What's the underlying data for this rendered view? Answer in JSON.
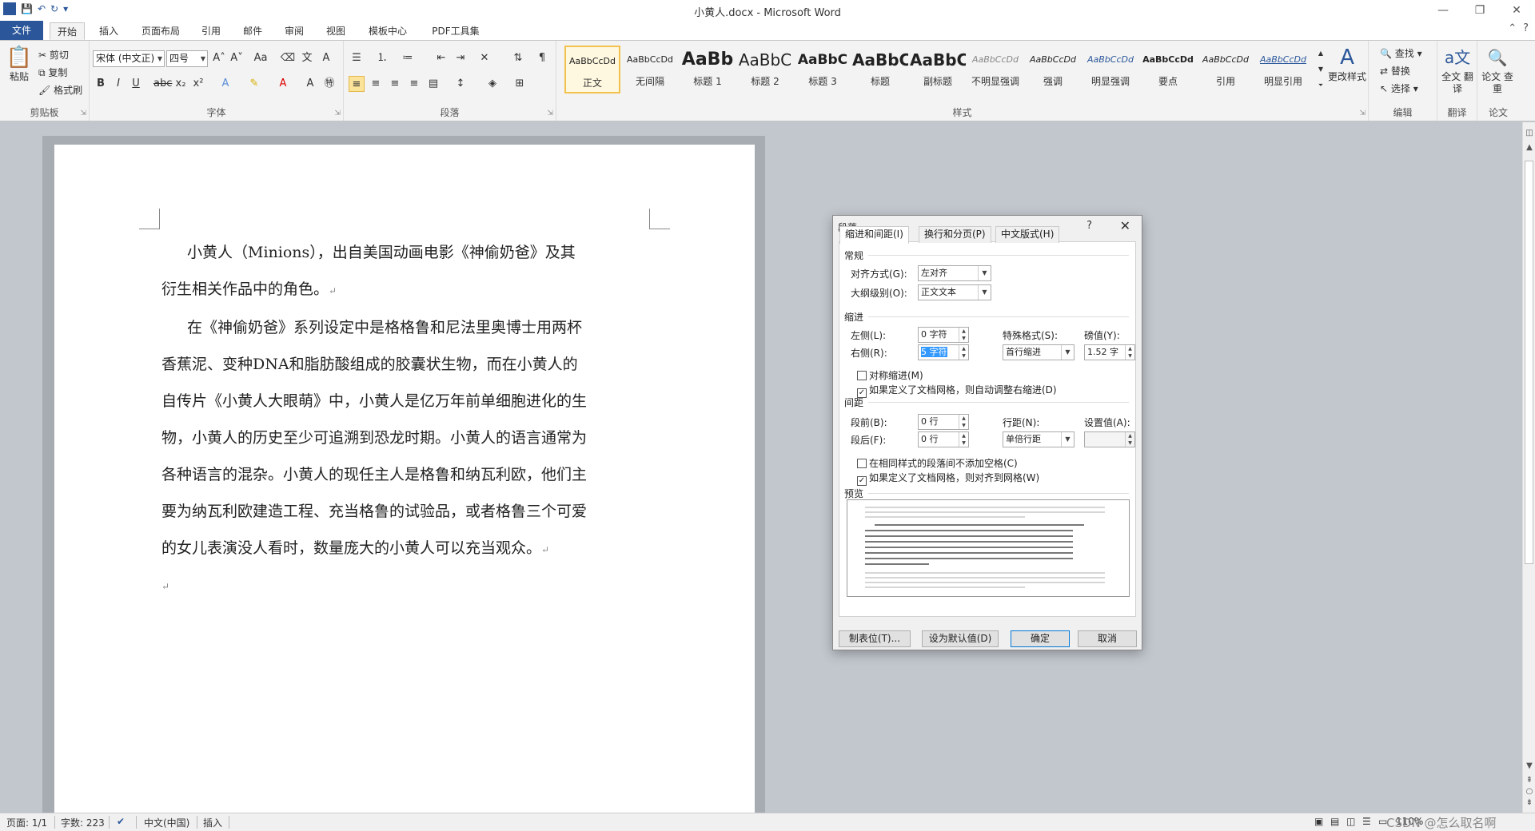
{
  "window": {
    "title": "小黄人.docx - Microsoft Word",
    "logo": "W"
  },
  "tabs": [
    "文件",
    "开始",
    "插入",
    "页面布局",
    "引用",
    "邮件",
    "审阅",
    "视图",
    "模板中心",
    "PDF工具集"
  ],
  "ribbon": {
    "clipboard": {
      "label": "剪贴板",
      "paste": "粘贴",
      "cut": "剪切",
      "copy": "复制",
      "format_painter": "格式刷"
    },
    "font": {
      "label": "字体",
      "font_name": "宋体 (中文正)",
      "font_size": "四号"
    },
    "paragraph": {
      "label": "段落"
    },
    "styles": {
      "label": "样式",
      "items": [
        {
          "preview": "AaBbCcDd",
          "name": "正文"
        },
        {
          "preview": "AaBbCcDd",
          "name": "无间隔"
        },
        {
          "preview": "AaBb",
          "name": "标题 1"
        },
        {
          "preview": "AaBbC",
          "name": "标题 2"
        },
        {
          "preview": "AaBbC",
          "name": "标题 3"
        },
        {
          "preview": "AaBbC",
          "name": "标题"
        },
        {
          "preview": "AaBbC",
          "name": "副标题"
        },
        {
          "preview": "AaBbCcDd",
          "name": "不明显强调"
        },
        {
          "preview": "AaBbCcDd",
          "name": "强调"
        },
        {
          "preview": "AaBbCcDd",
          "name": "明显强调"
        },
        {
          "preview": "AaBbCcDd",
          "name": "要点"
        },
        {
          "preview": "AaBbCcDd",
          "name": "引用"
        },
        {
          "preview": "AaBbCcDd",
          "name": "明显引用"
        }
      ],
      "change_styles": "更改样式"
    },
    "editing": {
      "label": "编辑",
      "find": "查找",
      "replace": "替换",
      "select": "选择"
    },
    "translate": {
      "label": "翻译",
      "btn": "全文 翻译"
    },
    "thesis": {
      "label": "论文",
      "btn": "论文 查重"
    }
  },
  "document": {
    "paragraphs": [
      "小黄人（Minions），出自美国动画电影《神偷奶爸》及其衍生相关作品中的角色。",
      "在《神偷奶爸》系列设定中是格格鲁和尼法里奥博士用两杯香蕉泥、变种DNA和脂肪酸组成的胶囊状生物，而在小黄人的自传片《小黄人大眼萌》中，小黄人是亿万年前单细胞进化的生物，小黄人的历史至少可追溯到恐龙时期。小黄人的语言通常为各种语言的混杂。小黄人的现任主人是格鲁和纳瓦利欧，他们主要为纳瓦利欧建造工程、充当格鲁的试验品，或者格鲁三个可爱的女儿表演没人看时，数量庞大的小黄人可以充当观众。"
    ],
    "para_mark": "↵"
  },
  "dialog": {
    "title": "段落",
    "help": "?",
    "close": "✕",
    "tabs": [
      "缩进和间距(I)",
      "换行和分页(P)",
      "中文版式(H)"
    ],
    "general": {
      "section": "常规",
      "alignment_label": "对齐方式(G):",
      "alignment_value": "左对齐",
      "outline_label": "大纲级别(O):",
      "outline_value": "正文文本"
    },
    "indent": {
      "section": "缩进",
      "left_label": "左侧(L):",
      "left_value": "0 字符",
      "right_label": "右侧(R):",
      "right_value": "5 字符",
      "special_label": "特殊格式(S):",
      "special_value": "首行缩进",
      "by_label": "磅值(Y):",
      "by_value": "1.52 字",
      "mirror": "对称缩进(M)",
      "auto_adjust": "如果定义了文档网格，则自动调整右缩进(D)"
    },
    "spacing": {
      "section": "间距",
      "before_label": "段前(B):",
      "before_value": "0 行",
      "after_label": "段后(F):",
      "after_value": "0 行",
      "line_label": "行距(N):",
      "line_value": "单倍行距",
      "at_label": "设置值(A):",
      "at_value": "",
      "no_space": "在相同样式的段落间不添加空格(C)",
      "snap_grid": "如果定义了文档网格，则对齐到网格(W)"
    },
    "preview_label": "预览",
    "buttons": {
      "tabs": "制表位(T)...",
      "default": "设为默认值(D)",
      "ok": "确定",
      "cancel": "取消"
    }
  },
  "status": {
    "page": "页面: 1/1",
    "words": "字数: 223",
    "lang": "中文(中国)",
    "mode": "插入",
    "zoom": "110%",
    "watermark": "CSDN @怎么取名啊"
  }
}
